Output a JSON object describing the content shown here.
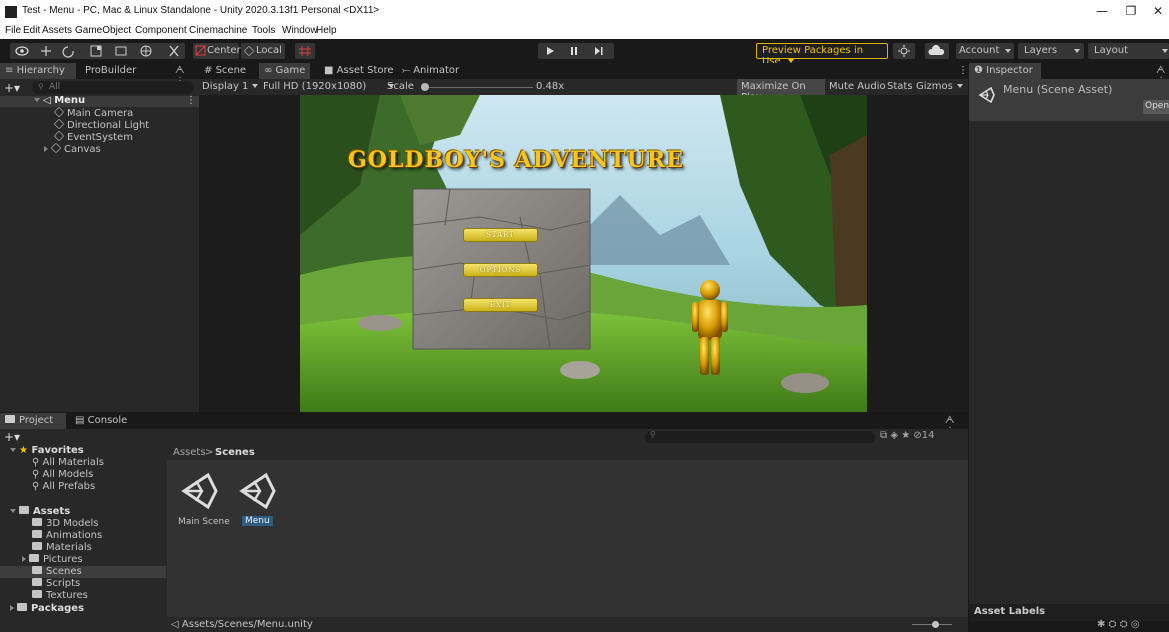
{
  "window": {
    "title": "Test - Menu - PC, Mac & Linux Standalone - Unity 2020.3.13f1 Personal <DX11>",
    "minimize_glyph": "—",
    "maximize_glyph": "❐",
    "close_glyph": "✕"
  },
  "menubar": [
    "File",
    "Edit",
    "Assets",
    "GameObject",
    "Component",
    "Cinemachine",
    "Tools",
    "Window",
    "Help"
  ],
  "toolbar": {
    "center_label": "Center",
    "local_label": "Local",
    "preview_packages_label": "Preview Packages in Use",
    "account_label": "Account",
    "layers_label": "Layers",
    "layout_label": "Layout"
  },
  "hierarchy": {
    "tabs": [
      "Hierarchy",
      "ProBuilder"
    ],
    "search_placeholder": "All",
    "scene_name": "Menu",
    "items": [
      "Main Camera",
      "Directional Light",
      "EventSystem",
      "Canvas"
    ]
  },
  "scene_tabs": [
    "Scene",
    "Game",
    "Asset Store",
    "Animator"
  ],
  "game_toolbar": {
    "display": "Display 1",
    "resolution": "Full HD (1920x1080)",
    "scale_label": "Scale",
    "scale_value": 0.48,
    "scale_text": "0.48x",
    "maximize_on_play": "Maximize On Play",
    "mute_audio": "Mute Audio",
    "stats": "Stats",
    "gizmos": "Gizmos"
  },
  "game": {
    "title": "GOLDBOY'S ADVENTURE",
    "buttons": [
      "START",
      "OPTIONS",
      "EXIT"
    ]
  },
  "inspector": {
    "tab": "Inspector",
    "asset_title": "Menu (Scene Asset)",
    "open_label": "Open",
    "asset_labels": "Asset Labels"
  },
  "project": {
    "tabs": [
      "Project",
      "Console"
    ],
    "favorites_label": "Favorites",
    "favorites": [
      "All Materials",
      "All Models",
      "All Prefabs"
    ],
    "assets_label": "Assets",
    "asset_folders": [
      "3D Models",
      "Animations",
      "Materials",
      "Pictures",
      "Scenes",
      "Scripts",
      "Textures"
    ],
    "packages_label": "Packages",
    "breadcrumb_root": "Assets",
    "breadcrumb_sep": ">",
    "breadcrumb_current": "Scenes",
    "files": [
      "Main Scene",
      "Menu"
    ],
    "status_path": "Assets/Scenes/Menu.unity",
    "hidden_count": "14"
  },
  "colors": {
    "accent_blue": "#2c5d87",
    "preview_yellow": "#f3c000",
    "panel_bg": "#282828"
  }
}
